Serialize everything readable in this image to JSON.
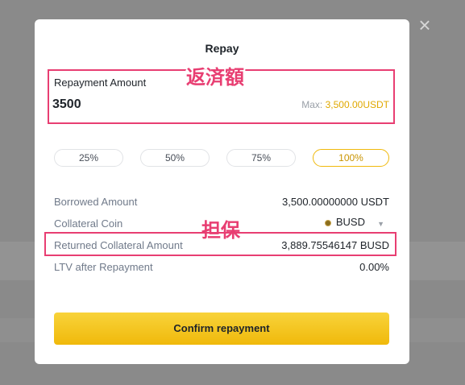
{
  "modal": {
    "title": "Repay",
    "close_icon": "close-icon"
  },
  "repayment": {
    "label": "Repayment Amount",
    "value": "3500",
    "max_prefix": "Max:",
    "max_value": "3,500.00USDT"
  },
  "percent_options": [
    {
      "label": "25%",
      "active": false
    },
    {
      "label": "50%",
      "active": false
    },
    {
      "label": "75%",
      "active": false
    },
    {
      "label": "100%",
      "active": true
    }
  ],
  "details": {
    "borrowed_label": "Borrowed Amount",
    "borrowed_value": "3,500.00000000 USDT",
    "collateral_coin_label": "Collateral Coin",
    "collateral_coin_value": "BUSD",
    "collateral_coin_icon": "busd-coin-icon",
    "dropdown_icon": "chevron-down-icon",
    "returned_label": "Returned Collateral Amount",
    "returned_value": "3,889.75546147 BUSD",
    "ltv_label": "LTV after Repayment",
    "ltv_value": "0.00%"
  },
  "annotations": {
    "repay_amount_jp": "返済額",
    "collateral_jp": "担保",
    "highlight_color": "#e83e72"
  },
  "confirm_label": "Confirm repayment",
  "colors": {
    "accent": "#f0b90b",
    "max_value": "#e0a800",
    "overlay": "#8a8a8a"
  }
}
